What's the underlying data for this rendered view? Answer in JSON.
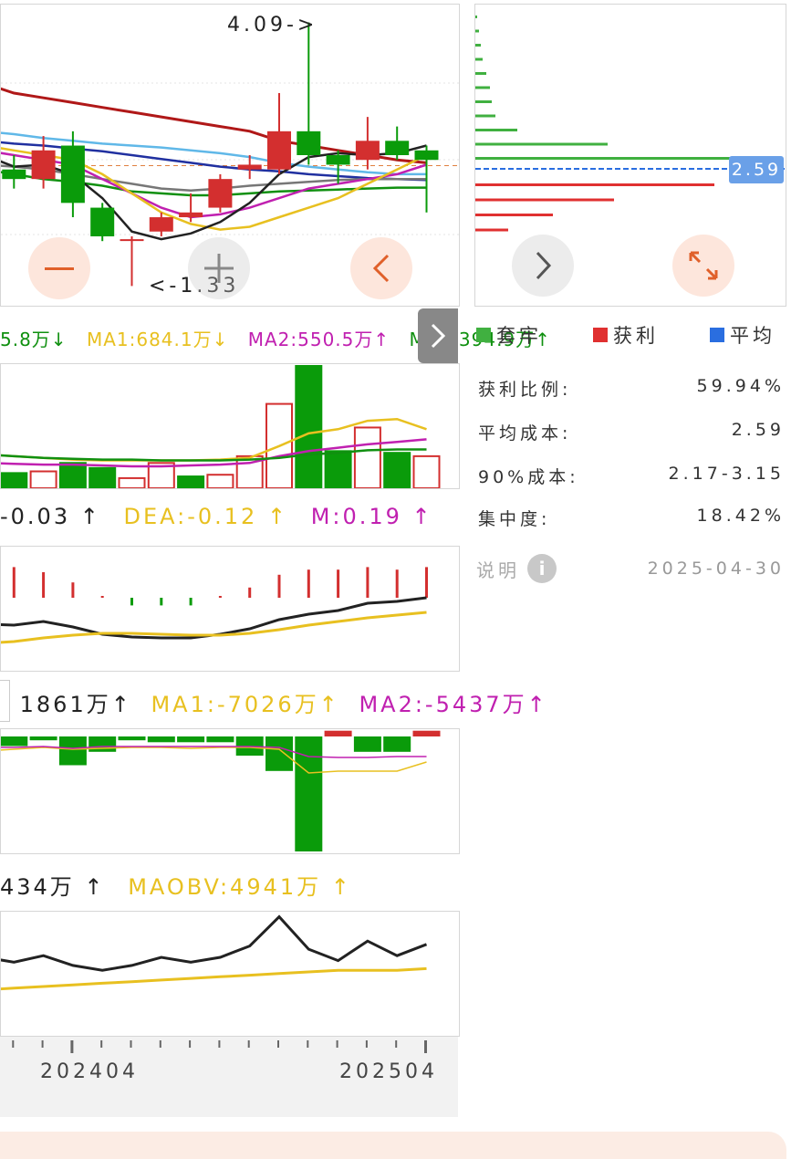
{
  "main_chart": {
    "high_marker": "4.09->",
    "low_marker": "<-1.33",
    "cost_price_tag": "2.59"
  },
  "ma_legend": {
    "partial": "5.8万↓",
    "ma1": "MA1:684.1万↓",
    "ma2": "MA2:550.5万↑",
    "ma3": "MA3:394.9万↑"
  },
  "macd_legend": {
    "partial": "-0.03 ↑",
    "dea": "DEA:-0.12 ↑",
    "m": "M:0.19 ↑"
  },
  "fund_legend": {
    "partial": "1861万↑",
    "ma1": "MA1:-7026万↑",
    "ma2": "MA2:-5437万↑"
  },
  "obv_legend": {
    "partial": "434万 ↑",
    "maobv": "MAOBV:4941万 ↑"
  },
  "x_axis": {
    "labels": [
      "202404",
      "202504"
    ]
  },
  "chip_panel": {
    "legend": {
      "trapped": "套牢",
      "profit": "获利",
      "average": "平均"
    },
    "stats": [
      {
        "label": "获利比例:",
        "value": "59.94%"
      },
      {
        "label": "平均成本:",
        "value": "2.59"
      },
      {
        "label": "90%成本:",
        "value": "2.17-3.15"
      },
      {
        "label": "集中度:",
        "value": "18.42%"
      }
    ],
    "note_label": "说明",
    "note_date": "2025-04-30"
  },
  "colors": {
    "up": "#d32f2f",
    "down": "#0a9b0a",
    "ma_yellow": "#e8c020",
    "ma_magenta": "#c020b0",
    "ma_black": "#222222",
    "ma_blue": "#2030a0",
    "ma_lightblue": "#60b8e8",
    "ma_darkred": "#b01818",
    "ma_green": "#109010",
    "ma_gray": "#777777",
    "accent": "#e0602a"
  },
  "icons": [
    "minus-icon",
    "chevron-left-icon",
    "chevron-right-icon",
    "expand-icon",
    "crosshair-icon",
    "info-icon"
  ],
  "chart_data": {
    "type": "candlestick",
    "categories": [
      "c1",
      "c2",
      "c3",
      "c4",
      "c5",
      "c6",
      "c7",
      "c8",
      "c9",
      "c10",
      "c11",
      "c12",
      "c13",
      "c14",
      "c15"
    ],
    "candles": [
      {
        "open": 2.9,
        "close": 2.65,
        "high": 3.0,
        "low": 2.55
      },
      {
        "open": 2.55,
        "close": 2.45,
        "high": 2.7,
        "low": 2.35
      },
      {
        "open": 2.45,
        "close": 2.75,
        "high": 2.9,
        "low": 2.35
      },
      {
        "open": 2.8,
        "close": 2.2,
        "high": 2.95,
        "low": 2.05
      },
      {
        "open": 2.15,
        "close": 1.85,
        "high": 2.2,
        "low": 1.8
      },
      {
        "open": 1.82,
        "close": 1.82,
        "high": 1.85,
        "low": 1.33
      },
      {
        "open": 1.9,
        "close": 2.05,
        "high": 2.1,
        "low": 1.85
      },
      {
        "open": 2.05,
        "close": 2.1,
        "high": 2.3,
        "low": 2.0
      },
      {
        "open": 2.15,
        "close": 2.45,
        "high": 2.5,
        "low": 2.1
      },
      {
        "open": 2.55,
        "close": 2.6,
        "high": 2.7,
        "low": 2.45
      },
      {
        "open": 2.55,
        "close": 2.95,
        "high": 3.35,
        "low": 2.5
      },
      {
        "open": 2.95,
        "close": 2.7,
        "high": 4.09,
        "low": 2.6
      },
      {
        "open": 2.7,
        "close": 2.6,
        "high": 2.75,
        "low": 2.4
      },
      {
        "open": 2.65,
        "close": 2.85,
        "high": 3.1,
        "low": 2.55
      },
      {
        "open": 2.85,
        "close": 2.7,
        "high": 3.0,
        "low": 2.65
      },
      {
        "open": 2.75,
        "close": 2.65,
        "high": 2.8,
        "low": 2.1
      }
    ],
    "volume": [
      22,
      18,
      20,
      30,
      24,
      12,
      30,
      14,
      16,
      38,
      100,
      145,
      44,
      72,
      42,
      38
    ],
    "volume_up": [
      false,
      false,
      true,
      false,
      false,
      true,
      true,
      false,
      true,
      true,
      true,
      false,
      false,
      true,
      false,
      true
    ],
    "macd_bars": [
      0.1,
      0.12,
      0.1,
      0.06,
      0.0,
      -0.03,
      -0.03,
      -0.03,
      0.0,
      0.04,
      0.09,
      0.11,
      0.11,
      0.12,
      0.11,
      0.12
    ],
    "fund_bars": [
      -10,
      -5,
      -2,
      -15,
      -8,
      -2,
      -3,
      -3,
      -3,
      -10,
      -18,
      -60,
      3,
      -8,
      -8,
      3
    ],
    "obv": [
      45,
      42,
      46,
      40,
      37,
      40,
      45,
      42,
      45,
      52,
      70,
      50,
      43,
      55,
      46,
      53
    ],
    "maobv": [
      25,
      26,
      27,
      28,
      29,
      30,
      31,
      32,
      33,
      34,
      35,
      36,
      37,
      37,
      37,
      38
    ]
  }
}
